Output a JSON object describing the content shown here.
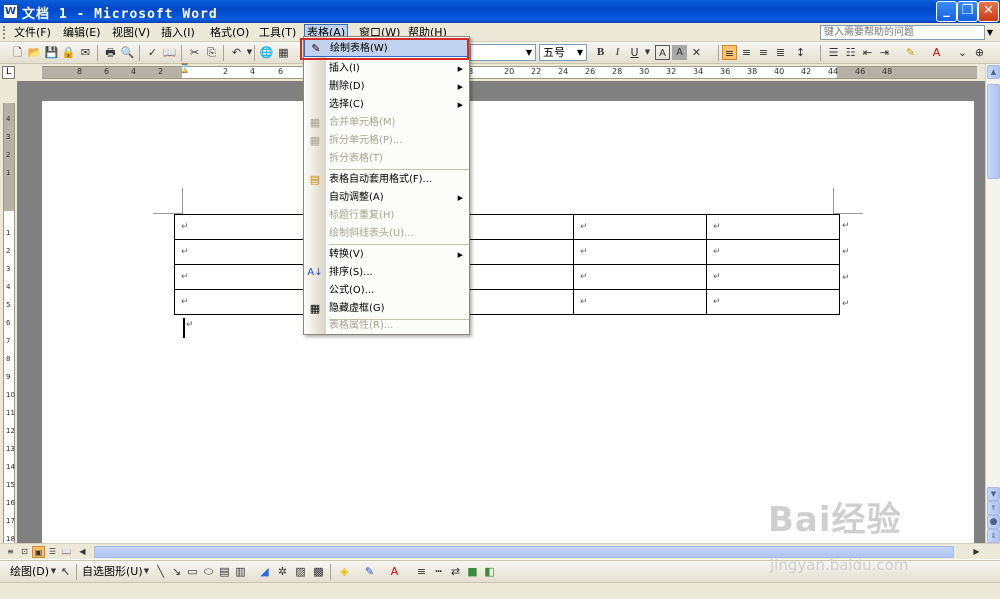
{
  "window": {
    "title": "文档 1 - Microsoft Word",
    "icon": "word-doc-icon"
  },
  "menubar": {
    "items": [
      "文件(F)",
      "编辑(E)",
      "视图(V)",
      "插入(I)",
      "格式(O)",
      "工具(T)",
      "表格(A)",
      "窗口(W)",
      "帮助(H)"
    ],
    "active": "表格(A)",
    "help_placeholder": "键入需要帮助的问题"
  },
  "toolbar": {
    "font_size": "五号"
  },
  "ruler_h": {
    "numbers": [
      "8",
      "6",
      "4",
      "2",
      "2",
      "4",
      "6",
      "8",
      "20",
      "22",
      "24",
      "26",
      "28",
      "30",
      "32",
      "34",
      "36",
      "38",
      "40",
      "42",
      "44",
      "46",
      "48"
    ]
  },
  "ruler_v": {
    "numbers": [
      "4",
      "3",
      "2",
      "1",
      "1",
      "2",
      "3",
      "4",
      "5",
      "6",
      "7",
      "8",
      "9",
      "10",
      "11",
      "12",
      "13",
      "14",
      "15",
      "16",
      "17",
      "18"
    ]
  },
  "table_menu": {
    "items": [
      {
        "label": "绘制表格(W)",
        "icon": "pencil-icon",
        "enabled": true,
        "submenu": false,
        "highlighted": true
      },
      {
        "label": "插入(I)",
        "icon": "",
        "enabled": true,
        "submenu": true
      },
      {
        "label": "删除(D)",
        "icon": "",
        "enabled": true,
        "submenu": true
      },
      {
        "label": "选择(C)",
        "icon": "",
        "enabled": true,
        "submenu": true
      },
      {
        "label": "合并单元格(M)",
        "icon": "merge-cells-icon",
        "enabled": false,
        "submenu": false
      },
      {
        "label": "拆分单元格(P)...",
        "icon": "split-cells-icon",
        "enabled": false,
        "submenu": false
      },
      {
        "label": "拆分表格(T)",
        "icon": "",
        "enabled": false,
        "submenu": false
      },
      {
        "label": "表格自动套用格式(F)...",
        "icon": "autoformat-icon",
        "enabled": true,
        "submenu": false
      },
      {
        "label": "自动调整(A)",
        "icon": "",
        "enabled": true,
        "submenu": true
      },
      {
        "label": "标题行重复(H)",
        "icon": "",
        "enabled": false,
        "submenu": false
      },
      {
        "label": "绘制斜线表头(U)...",
        "icon": "",
        "enabled": false,
        "submenu": false
      },
      {
        "label": "转换(V)",
        "icon": "",
        "enabled": true,
        "submenu": true
      },
      {
        "label": "排序(S)...",
        "icon": "sort-icon",
        "enabled": true,
        "submenu": false
      },
      {
        "label": "公式(O)...",
        "icon": "",
        "enabled": true,
        "submenu": false
      },
      {
        "label": "隐藏虚框(G)",
        "icon": "grid-icon",
        "enabled": true,
        "submenu": false
      },
      {
        "label": "表格属性(R)...",
        "icon": "",
        "enabled": false,
        "submenu": false
      }
    ]
  },
  "document": {
    "paragraph_mark": "↵"
  },
  "drawbar": {
    "draw_label": "绘图(D)",
    "autoshape_label": "自选图形(U)"
  },
  "watermark": {
    "brand": "Bai经验",
    "url": "jingyan.baidu.com"
  },
  "colors": {
    "menu_highlight": "#c1d2ee",
    "highlight_border": "#316ac5",
    "callout_red": "#d42a2a",
    "titlebar": "#0047c8"
  }
}
